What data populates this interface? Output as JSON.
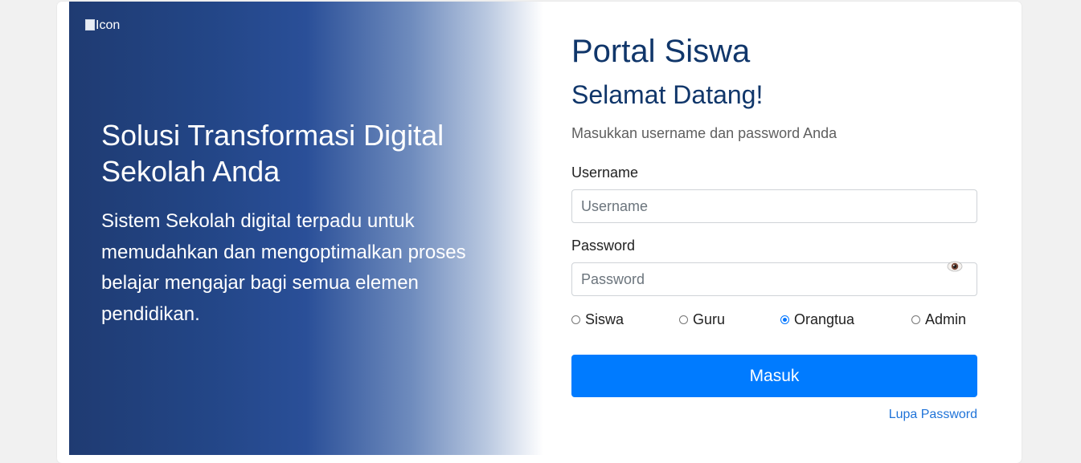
{
  "hero": {
    "logo_alt": "Icon",
    "title": "Solusi Transformasi Digital Sekolah Anda",
    "description": "Sistem Sekolah digital terpadu untuk memudahkan dan mengoptimalkan proses belajar mengajar bagi semua elemen pendidikan."
  },
  "login": {
    "portal_title": "Portal Siswa",
    "welcome": "Selamat Datang!",
    "instruction": "Masukkan username dan password Anda",
    "username_label": "Username",
    "username_placeholder": "Username",
    "username_value": "",
    "password_label": "Password",
    "password_placeholder": "Password",
    "password_value": "",
    "roles": [
      {
        "label": "Siswa",
        "checked": false
      },
      {
        "label": "Guru",
        "checked": false
      },
      {
        "label": "Orangtua",
        "checked": true
      },
      {
        "label": "Admin",
        "checked": false
      }
    ],
    "submit_label": "Masuk",
    "forgot_label": "Lupa Password"
  },
  "icons": {
    "show_password": "eye-icon",
    "logo": "broken-image-icon"
  },
  "colors": {
    "primary": "#007bff",
    "heading": "#10366a",
    "hero_dark": "#1f3b72",
    "link": "#1f73d8"
  }
}
